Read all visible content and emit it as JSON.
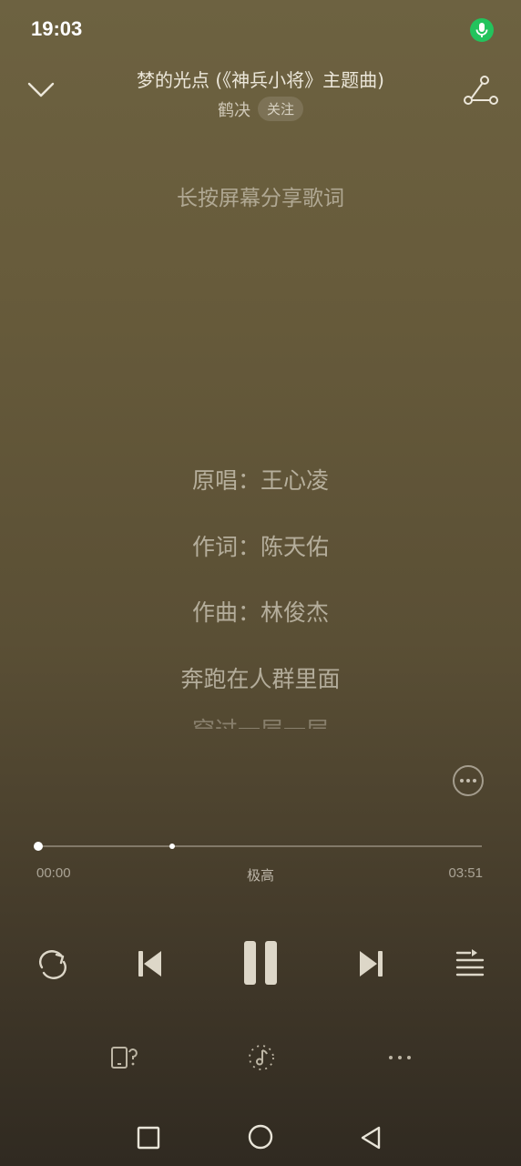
{
  "status": {
    "time": "19:03",
    "mic_indicator": "mic-icon",
    "mic_color": "#23c35d"
  },
  "header": {
    "title": "梦的光点 (《神兵小将》主题曲)",
    "artist": "鹤决",
    "follow_label": "关注",
    "collapse_icon": "chevron-down-icon",
    "share_icon": "share-icon"
  },
  "lyrics": {
    "hint": "长按屏幕分享歌词",
    "lines": [
      "原唱：王心凌",
      "作词：陈天佑",
      "作曲：林俊杰",
      "奔跑在人群里面"
    ],
    "next_partial": "穿过一层一层"
  },
  "player": {
    "current_time": "00:00",
    "total_time": "03:51",
    "quality": "极高",
    "progress": 0.0,
    "buffered_marker": 0.3
  },
  "controls": {
    "repeat_icon": "repeat-icon",
    "prev_icon": "skip-previous-icon",
    "play_state": "playing",
    "pause_icon": "pause-icon",
    "next_icon": "skip-next-icon",
    "playlist_icon": "playlist-icon"
  },
  "secondary_controls": {
    "device_icon": "device-switch-icon",
    "effect_icon": "sound-effect-icon",
    "more_icon": "more-icon"
  },
  "nav": {
    "recent": "square-icon",
    "home": "circle-icon",
    "back": "triangle-back-icon"
  },
  "colors": {
    "accent_green": "#23c35d",
    "background_top": "#6d6241",
    "background_bottom": "#302a21"
  }
}
